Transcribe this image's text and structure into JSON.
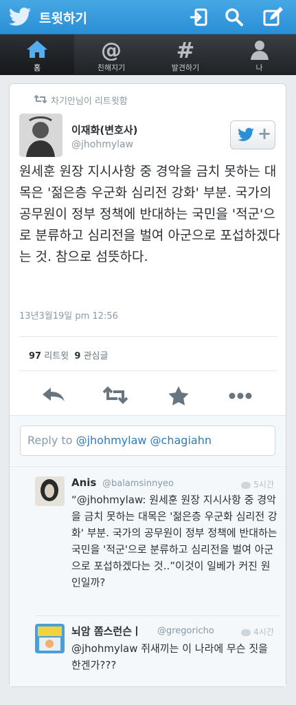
{
  "header": {
    "title": "트윗하기"
  },
  "nav": {
    "items": [
      {
        "label": "홈",
        "icon": "home-icon"
      },
      {
        "label": "친해지기",
        "icon": "at-icon"
      },
      {
        "label": "발견하기",
        "icon": "hashtag-icon"
      },
      {
        "label": "나",
        "icon": "person-icon"
      }
    ]
  },
  "tweet": {
    "retweeted_by": "차기안님이 리트윗함",
    "name": "이재화(변호사)",
    "handle": "@jhohmylaw",
    "text": "원세훈 원장 지시사항 중 경악을 금치 못하는 대목은 '젊은층 우군화 심리전 강화' 부분. 국가의 공무원이 정부 정책에 반대하는 국민을 '적군'으로 분류하고 심리전을 벌여 아군으로 포섭하겠다는 것. 참으로 섬뜻하다.",
    "timestamp": "13년3월19일 pm 12:56",
    "retweets": "97",
    "retweets_label": "리트윗",
    "favorites": "9",
    "favorites_label": "관심글"
  },
  "reply_box": {
    "prefix": "Reply to",
    "mentions": "@jhohmylaw @chagiahn"
  },
  "replies": [
    {
      "name": "Anis",
      "handle": "@balamsinnyeo",
      "time": "5시간",
      "text": "“@jhohmylaw: 원세훈 원장 지시사항 중 경악을 금치 못하는 대목은 '젊은층 우군화 심리전 강화' 부분. 국가의 공무원이 정부 정책에 반대하는 국민을 '적군'으로 분류하고 심리전을 벌여 아군으로 포섭하겠다는 것..”이것이 일베가 커진 원인일까?"
    },
    {
      "name": "뇌암 쫌스런슨ㅣ",
      "handle": "@gregoricho",
      "time": "4시간",
      "text": "@jhohmylaw 쥐새끼는 이 나라에 무슨 짓을 한겐가???"
    }
  ],
  "colors": {
    "topbar": "#2b8fd6",
    "navbar": "#2a2d31",
    "link": "#2b7bb9",
    "muted": "#8899a6"
  }
}
